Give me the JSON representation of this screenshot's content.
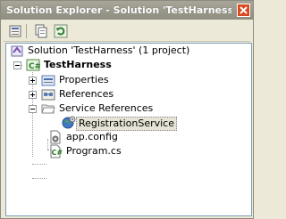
{
  "window": {
    "title": "Solution Explorer - Solution 'TestHarness' (1 ...",
    "close_icon": "close-icon"
  },
  "toolbar": {
    "buttons": [
      "properties-icon",
      "show-all-files-icon",
      "refresh-icon"
    ]
  },
  "tree": {
    "solution": "Solution 'TestHarness' (1 project)",
    "project": "TestHarness",
    "items": [
      {
        "label": "Properties",
        "icon": "properties-folder-icon",
        "expander": "+"
      },
      {
        "label": "References",
        "icon": "references-folder-icon",
        "expander": "+"
      },
      {
        "label": "Service References",
        "icon": "folder-open-icon",
        "expander": "-"
      },
      {
        "label": "RegistrationService",
        "icon": "globe-service-icon",
        "selected": true
      },
      {
        "label": "app.config",
        "icon": "config-file-icon"
      },
      {
        "label": "Program.cs",
        "icon": "csharp-file-icon"
      }
    ]
  },
  "colors": {
    "titlebar": "#9a988b",
    "selection": "#e6e4d6",
    "close": "#d9481e"
  }
}
